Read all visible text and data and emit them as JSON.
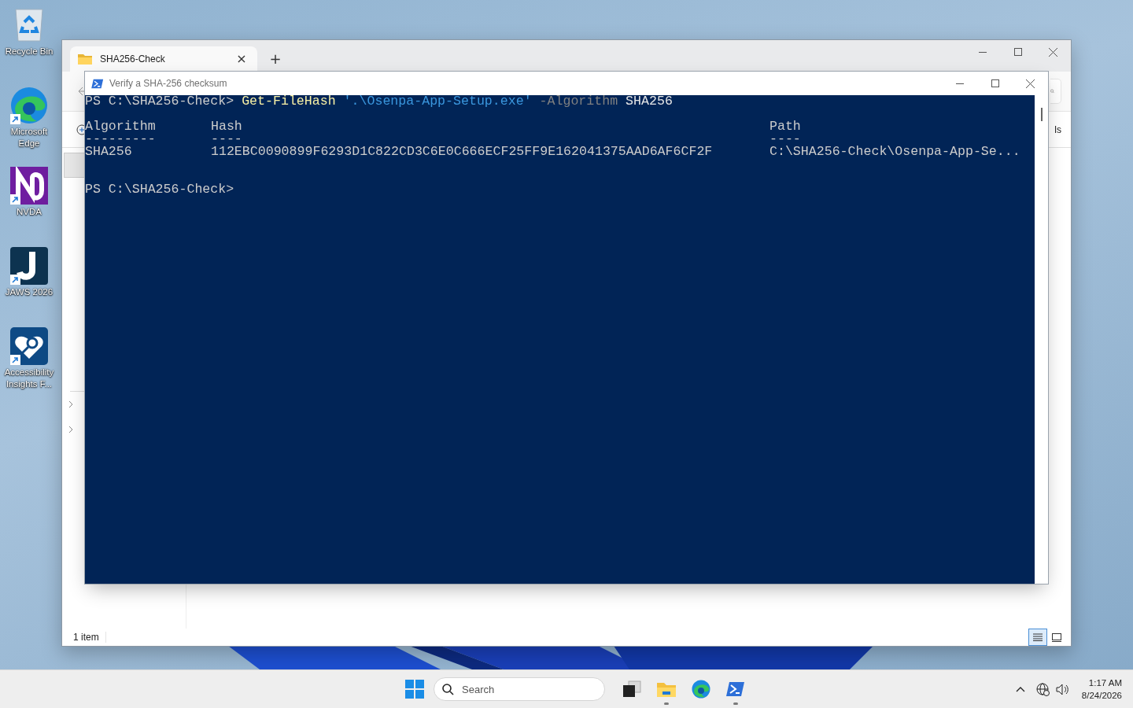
{
  "desktop_icons": [
    {
      "label": "Recycle Bin",
      "kind": "recycle",
      "shortcut": false
    },
    {
      "label": "Microsoft Edge",
      "kind": "edge",
      "shortcut": true
    },
    {
      "label": "NVDA",
      "kind": "nvda",
      "shortcut": true
    },
    {
      "label": "JAWS 2026",
      "kind": "jaws",
      "shortcut": true
    },
    {
      "label": "Accessibility Insights F...",
      "kind": "insights",
      "shortcut": true
    }
  ],
  "explorer": {
    "tab": {
      "title": "SHA256-Check",
      "close": "×"
    },
    "new_tab": "+",
    "toolbar_fragment": "ls",
    "status": "1 item",
    "view_buttons": [
      {
        "kind": "details",
        "selected": true
      },
      {
        "kind": "tiles",
        "selected": false
      }
    ]
  },
  "terminal": {
    "title": "Verify a SHA-256 checksum",
    "command": [
      {
        "kind": "prompt",
        "text": "PS C:\\SHA256-Check>"
      },
      {
        "kind": "command",
        "text": "Get-FileHash"
      },
      {
        "kind": "string",
        "text": "'.\\Osenpa-App-Setup.exe'"
      },
      {
        "kind": "parameter",
        "text": "-Algorithm"
      },
      {
        "kind": "argument",
        "text": "SHA256"
      }
    ],
    "output": {
      "columns": [
        "Algorithm",
        "Hash",
        "Path"
      ],
      "separators": [
        "---------",
        "----",
        "----"
      ],
      "rows": [
        [
          "SHA256",
          "112EBC0090899F6293D1C822CD3C6E0C666ECF25FF9E162041375AAD6AF6CF2F",
          "C:\\SHA256-Check\\Osenpa-App-Se..."
        ]
      ]
    },
    "prompt": "PS C:\\SHA256-Check>"
  },
  "taskbar": {
    "search": {
      "placeholder": "Search"
    },
    "apps": [
      {
        "kind": "taskview",
        "running": false
      },
      {
        "kind": "explorer",
        "running": true
      },
      {
        "kind": "edge",
        "running": false
      },
      {
        "kind": "powershell",
        "running": true
      }
    ],
    "time": "1:17 AM",
    "date": "8/24/2026"
  }
}
